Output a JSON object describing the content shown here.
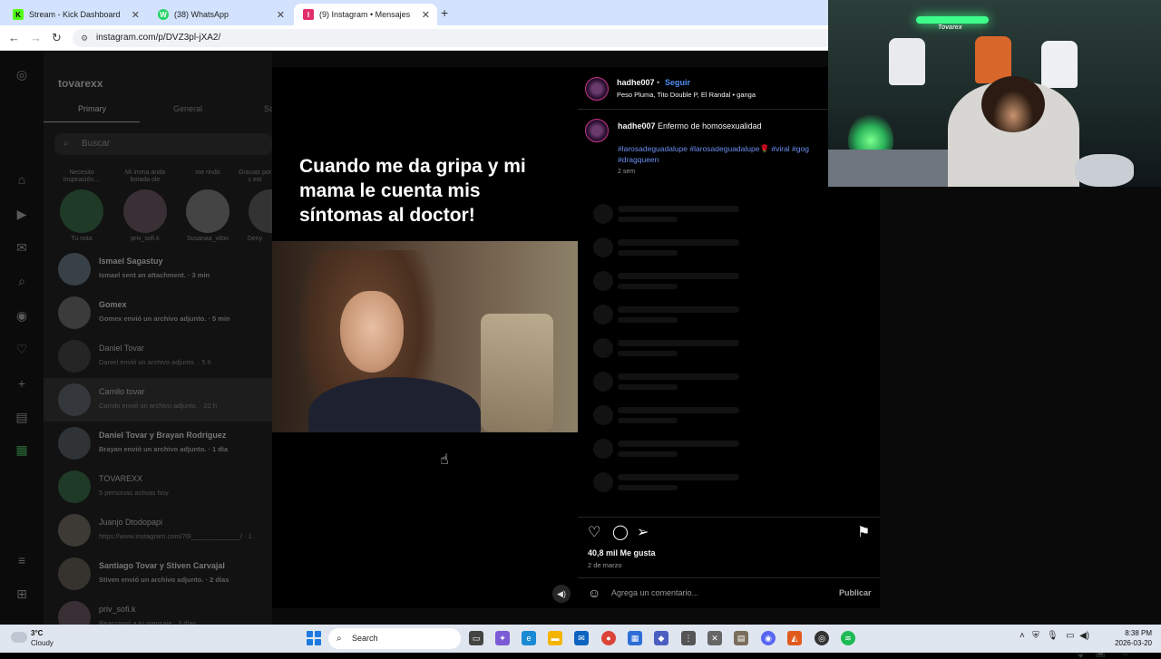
{
  "browser": {
    "tabs": [
      {
        "label": "Stream - Kick Dashboard",
        "fav_letter": "K"
      },
      {
        "label": "(38) WhatsApp",
        "fav_letter": "W"
      },
      {
        "label": "(9) Instagram • Mensajes",
        "fav_letter": "I"
      }
    ],
    "new_tab": "+",
    "url": "instagram.com/p/DVZ3pl-jXA2/"
  },
  "inbox": {
    "username": "tovarexx",
    "tabs": [
      "Primary",
      "General",
      "So"
    ],
    "search_placeholder": "Buscar",
    "stories": [
      {
        "bubble": "Necesito inspiración…",
        "name": "Tu nota"
      },
      {
        "bubble": "Mi imma anda botada ole",
        "name": "priv_sofi.k"
      },
      {
        "bubble": "me rindo",
        "name": "Susanaa_viloo"
      },
      {
        "bubble": "Gracias por c est",
        "name": "Deny"
      }
    ],
    "chats": [
      {
        "name": "Ismael Sagastuy",
        "msg": "Ismael sent an attachment. · 3 min"
      },
      {
        "name": "Gomex",
        "msg": "Gomex envió un archivo adjunto. · 5 min"
      },
      {
        "name": "Daniel Tovar",
        "msg": "Daniel envió un archivo adjunto. · 5 h"
      },
      {
        "name": "Camilo tovar",
        "msg": "Camilo envió un archivo adjunto. · 22 h"
      },
      {
        "name": "Daniel Tovar y Brayan Rodriguez",
        "msg": "Brayan envió un archivo adjunto. · 1 día"
      },
      {
        "name": "TOVAREXX",
        "msg": "5 personas activas hoy"
      },
      {
        "name": "Juanjo Dtodopapi",
        "msg": "https://www.instagram.com/76l_____________/ · 1"
      },
      {
        "name": "Santiago Tovar y Stiven Carvajal",
        "msg": "Stiven envió un archivo adjunto. · 2 días"
      },
      {
        "name": "priv_sofi.k",
        "msg": "Reaccionó  a tu mensaje · 3 días"
      }
    ]
  },
  "post": {
    "caption_overlay": "Cuando me da gripa y mi mama le cuenta mis síntomas al doctor!",
    "author": "hadhe007",
    "dot": "•",
    "follow": "Seguir",
    "music": "Peso Pluma, Tito Double P, El Randal • ganga",
    "comment_author": "hadhe007",
    "comment_text": "Enfermo de homosexualidad",
    "tags": "#larosadeguadalupe #larosadeguadalupe🌹 #viral #gog #dragqueen",
    "comment_time": "2 sem",
    "likes": "40,8 mil Me gusta",
    "date": "2 de marzo",
    "comment_placeholder": "Agrega un comentario...",
    "publish": "Publicar"
  },
  "webcam": {
    "label": "Tovarex"
  },
  "taskbar": {
    "temp": "3°C",
    "condition": "Cloudy",
    "search": "Search",
    "time": "8:38 PM",
    "date": "2026-03-20"
  },
  "icons": [
    "instagram-icon",
    "home-icon",
    "reels-icon",
    "messages-icon",
    "search-icon",
    "explore-icon",
    "heart-icon",
    "create-icon",
    "dashboard-icon",
    "menu-icon",
    "comment-icon",
    "share-icon",
    "bookmark-icon",
    "volume-icon",
    "emoji-icon"
  ]
}
